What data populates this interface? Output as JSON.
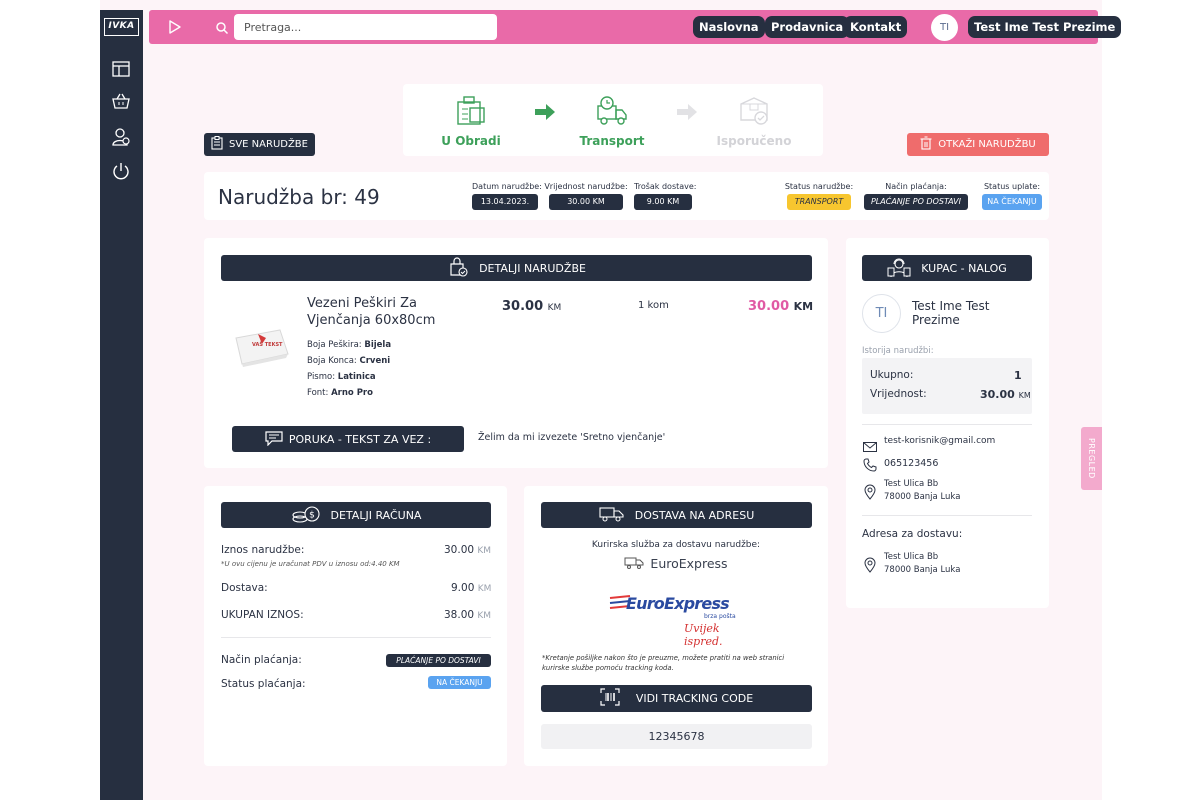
{
  "brand": {
    "logo_text": "IVKA"
  },
  "sidebar": {
    "items": [
      {
        "icon": "layout-icon"
      },
      {
        "icon": "basket-icon"
      },
      {
        "icon": "users-icon"
      },
      {
        "icon": "power-icon"
      }
    ]
  },
  "topbar": {
    "search_placeholder": "Pretraga...",
    "nav": [
      "Naslovna",
      "Prodavnica",
      "Kontakt"
    ],
    "avatar_initials": "TI",
    "user_name": "Test Ime Test Prezime"
  },
  "stepper": {
    "steps": [
      {
        "label": "U Obradi",
        "state": "done"
      },
      {
        "label": "Transport",
        "state": "active"
      },
      {
        "label": "Isporučeno",
        "state": "pending"
      }
    ]
  },
  "actions": {
    "all_orders": "SVE NARUDŽBE",
    "cancel_order": "OTKAŽI NARUDŽBU"
  },
  "order": {
    "title": "Narudžba br: 49",
    "date_label": "Datum narudžbe:",
    "date": "13.04.2023.",
    "value_label": "Vrijednost narudžbe:",
    "value": "30.00 KM",
    "shipping_label": "Trošak dostave:",
    "shipping": "9.00 KM",
    "status_label": "Status narudžbe:",
    "status": "TRANSPORT",
    "payment_label": "Način plaćanja:",
    "payment": "PLAĆANJE PO DOSTAVI",
    "payment_status_label": "Status uplate:",
    "payment_status": "NA ČEKANJU"
  },
  "details": {
    "heading": "DETALJI NARUDŽBE",
    "product": {
      "name_line1": "Vezeni Peškiri Za",
      "name_line2": "Vjenčanja 60x80cm",
      "image_caption": "VAŠ TEKST",
      "price": "30.00",
      "price_unit": "KM",
      "qty": "1 kom",
      "total": "30.00",
      "total_unit": "KM",
      "attrs": [
        {
          "label": "Boja Peškira:",
          "value": "Bijela"
        },
        {
          "label": "Boja Konca:",
          "value": "Crveni"
        },
        {
          "label": "Pismo:",
          "value": "Latinica"
        },
        {
          "label": "Font:",
          "value": "Arno Pro"
        }
      ]
    },
    "message_label": "PORUKA - TEKST ZA VEZ :",
    "message": "Želim da mi izvezete 'Sretno vjenčanje'"
  },
  "invoice": {
    "heading": "DETALJI RAČUNA",
    "order_amount_label": "Iznos narudžbe:",
    "order_amount": "30.00",
    "unit": "KM",
    "vat_note": "*U ovu cijenu je uračunat PDV u iznosu od:4.40 KM",
    "delivery_label": "Dostava:",
    "delivery": "9.00",
    "total_label": "UKUPAN IZNOS:",
    "total": "38.00",
    "payment_method_label": "Način plaćanja:",
    "payment_method": "PLAĆANJE PO DOSTAVI",
    "payment_status_label": "Status plaćanja:",
    "payment_status": "NA ČEKANJU"
  },
  "delivery": {
    "heading": "DOSTAVA NA ADRESU",
    "courier_label": "Kurirska služba za dostavu narudžbe:",
    "courier": "EuroExpress",
    "logo_main": "EuroExpress",
    "logo_sub": "brza pošta",
    "logo_slogan": "Uvijek ispred.",
    "note_line1": "*Kretanje pošiljke nakon što je preuzme, možete pratiti na web stranici",
    "note_line2": "kurirske službe pomoću tracking koda.",
    "tracking_button": "VIDI TRACKING CODE",
    "tracking_code": "12345678"
  },
  "customer": {
    "heading": "KUPAC - NALOG",
    "initials": "TI",
    "name_line1": "Test Ime Test",
    "name_line2": "Prezime",
    "history_label": "Istorija narudžbi:",
    "total_label": "Ukupno:",
    "total": "1",
    "value_label": "Vrijednost:",
    "value": "30.00",
    "value_unit": "KM",
    "email": "test-korisnik@gmail.com",
    "phone": "065123456",
    "address_line1": "Test Ulica Bb",
    "address_line2": "78000 Banja Luka",
    "delivery_address_label": "Adresa za dostavu:",
    "delivery_line1": "Test Ulica Bb",
    "delivery_line2": "78000 Banja Luka"
  },
  "side_tab": "PREGLED",
  "colors": {
    "pink": "#e96aa8",
    "dark": "#262f40",
    "green": "#3da05a",
    "red": "#ef6c6c",
    "yellow": "#f7c62f",
    "blue": "#5aa3f0"
  }
}
